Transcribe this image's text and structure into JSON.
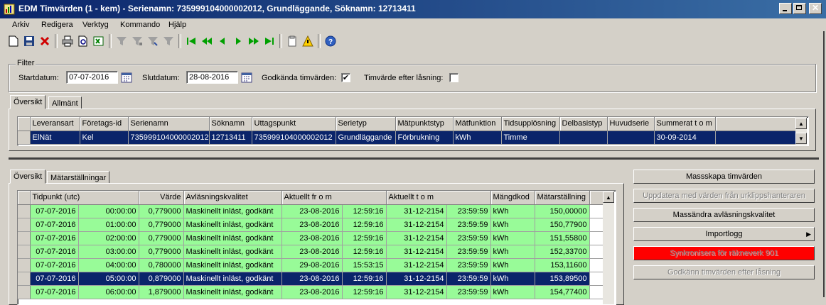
{
  "window": {
    "title": "EDM Timvärden (1 - kem) - Serienamn: 735999104000002012, Grundläggande, Söknamn: 12713411"
  },
  "menu": [
    "Arkiv",
    "Redigera",
    "Verktyg",
    "Kommando",
    "Hjälp"
  ],
  "filter": {
    "group_label": "Filter",
    "start_label": "Startdatum:",
    "start_value": "07-07-2016",
    "end_label": "Slutdatum:",
    "end_value": "28-08-2016",
    "approved_label": "Godkända timvärden:",
    "approved_checked": "✔",
    "after_lock_label": "Timvärde efter låsning:"
  },
  "top_tabs": [
    "Översikt",
    "Allmänt"
  ],
  "series_table": {
    "columns": [
      "Leveransart",
      "Företags-id",
      "Serienamn",
      "Söknamn",
      "Uttagspunkt",
      "Serietyp",
      "Mätpunktstyp",
      "Mätfunktion",
      "Tidsupplösning",
      "Delbasistyp",
      "Huvudserie",
      "Summerat t o m"
    ],
    "rows": [
      [
        "ElNät",
        "Kel",
        "735999104000002012",
        "12713411",
        "735999104000002012",
        "Grundläggande",
        "Förbrukning",
        "kWh",
        "Timme",
        "",
        "",
        "30-09-2014"
      ]
    ]
  },
  "bottom_tabs": [
    "Översikt",
    "Mätarställningar"
  ],
  "values_table": {
    "columns": [
      "Tidpunkt (utc)",
      "Värde",
      "Avläsningskvalitet",
      "Aktuellt fr o m",
      "Aktuellt t o m",
      "Mängdkod",
      "Mätarställning"
    ],
    "rows": [
      [
        "07-07-2016",
        "00:00:00",
        "0,779000",
        "Maskinellt inläst, godkänt",
        "23-08-2016",
        "12:59:16",
        "31-12-2154",
        "23:59:59",
        "kWh",
        "150,00000"
      ],
      [
        "07-07-2016",
        "01:00:00",
        "0,779000",
        "Maskinellt inläst, godkänt",
        "23-08-2016",
        "12:59:16",
        "31-12-2154",
        "23:59:59",
        "kWh",
        "150,77900"
      ],
      [
        "07-07-2016",
        "02:00:00",
        "0,779000",
        "Maskinellt inläst, godkänt",
        "23-08-2016",
        "12:59:16",
        "31-12-2154",
        "23:59:59",
        "kWh",
        "151,55800"
      ],
      [
        "07-07-2016",
        "03:00:00",
        "0,779000",
        "Maskinellt inläst, godkänt",
        "23-08-2016",
        "12:59:16",
        "31-12-2154",
        "23:59:59",
        "kWh",
        "152,33700"
      ],
      [
        "07-07-2016",
        "04:00:00",
        "0,780000",
        "Maskinellt inläst, godkänt",
        "29-08-2016",
        "15:53:15",
        "31-12-2154",
        "23:59:59",
        "kWh",
        "153,11600"
      ],
      [
        "07-07-2016",
        "05:00:00",
        "0,879000",
        "Maskinellt inläst, godkänt",
        "23-08-2016",
        "12:59:16",
        "31-12-2154",
        "23:59:59",
        "kWh",
        "153,89500"
      ],
      [
        "07-07-2016",
        "06:00:00",
        "1,879000",
        "Maskinellt inläst, godkänt",
        "23-08-2016",
        "12:59:16",
        "31-12-2154",
        "23:59:59",
        "kWh",
        "154,77400"
      ]
    ],
    "selected_row": 5
  },
  "actions": {
    "mass_create": "Massskapa timvärden",
    "update_clipboard": "Uppdatera med värden från urklippshanteraren",
    "mass_change": "Massändra avläsningskvalitet",
    "import_log": "Importlogg",
    "sync": "Synkronisera för räkneverk 901",
    "approve_after_lock": "Godkänn timvärden efter låsning"
  },
  "colors": {
    "title_start": "#0a246a",
    "title_end": "#3a6ea5",
    "row_green": "#98fb98",
    "selection": "#0a246a",
    "sync_red": "#ff0000"
  }
}
